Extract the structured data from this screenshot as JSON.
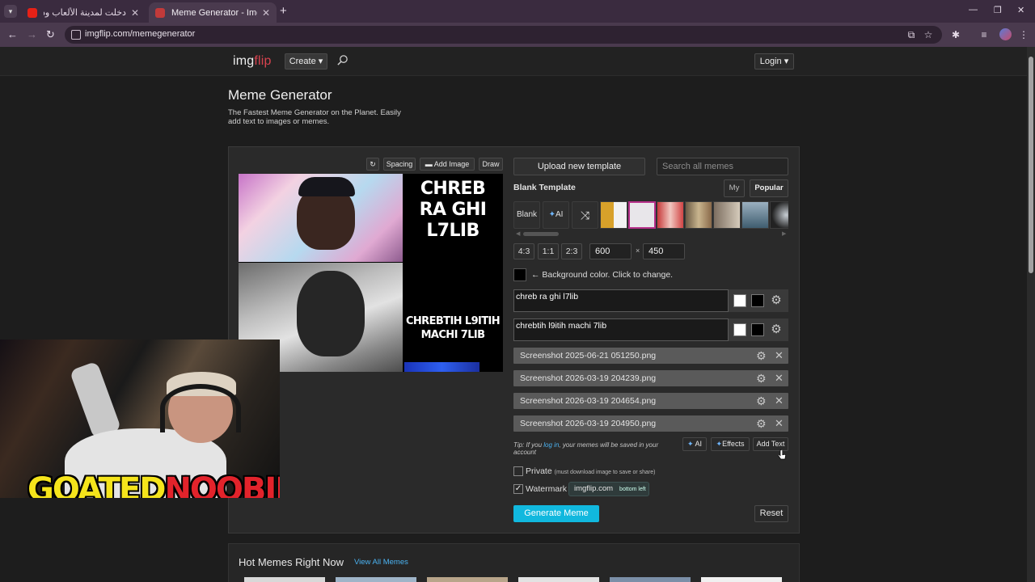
{
  "browser": {
    "tabs": [
      {
        "label": "دخلت لمدينة الألعاب ودارو ليا تتو",
        "active": false
      },
      {
        "label": "Meme Generator - Imgflip",
        "active": true
      }
    ],
    "url": "imgflip.com/memegenerator"
  },
  "site": {
    "logo_main": "img",
    "logo_accent": "flip",
    "create_label": "Create",
    "login_label": "Login"
  },
  "header": {
    "title": "Meme Generator",
    "subtitle": "The Fastest Meme Generator on the Planet. Easily add text to images or memes."
  },
  "meme_toolbar": {
    "spacing": "Spacing",
    "add_image": "Add Image",
    "draw": "Draw"
  },
  "meme_preview": {
    "top_text": "CHREB RA GHI L7LIB",
    "bottom_text": "CHREBTIH L9ITIH MACHI 7LIB"
  },
  "controls": {
    "upload": "Upload new template",
    "search_placeholder": "Search all memes",
    "blank_template": "Blank Template",
    "tab_my": "My",
    "tab_popular": "Popular",
    "tpl_blank": "Blank",
    "tpl_ai": "AI",
    "ratios": [
      "4:3",
      "1:1",
      "2:3"
    ],
    "width": "600",
    "height": "450",
    "times": "×",
    "bg_label": "← Background color. Click to change.",
    "text_boxes": [
      "chreb ra ghi l7lib",
      "chrebtih l9itih machi 7lib"
    ],
    "files": [
      "Screenshot 2025-06-21 051250.png",
      "Screenshot 2026-03-19 204239.png",
      "Screenshot 2026-03-19 204654.png",
      "Screenshot 2026-03-19 204950.png"
    ],
    "tip_prefix": "Tip: If you ",
    "tip_link": "log in",
    "tip_suffix": ", your memes will be saved in your account",
    "ai_btn": "AI",
    "effects_btn": "Effects",
    "add_text_btn": "Add Text",
    "private_label": "Private",
    "private_hint": "(must download image to save or share)",
    "watermark_label": "Watermark",
    "watermark_value": "imgflip.com",
    "watermark_pos": "bottom left",
    "generate": "Generate Meme",
    "reset": "Reset"
  },
  "hot": {
    "title": "Hot Memes Right Now",
    "view_all": "View All Memes"
  },
  "webcam": {
    "name_part1": "GOATED",
    "name_part2": "NOOBIE"
  },
  "colors": {
    "accent": "#11b8de",
    "logo_accent": "#d8434f",
    "link": "#4bb3f2"
  }
}
